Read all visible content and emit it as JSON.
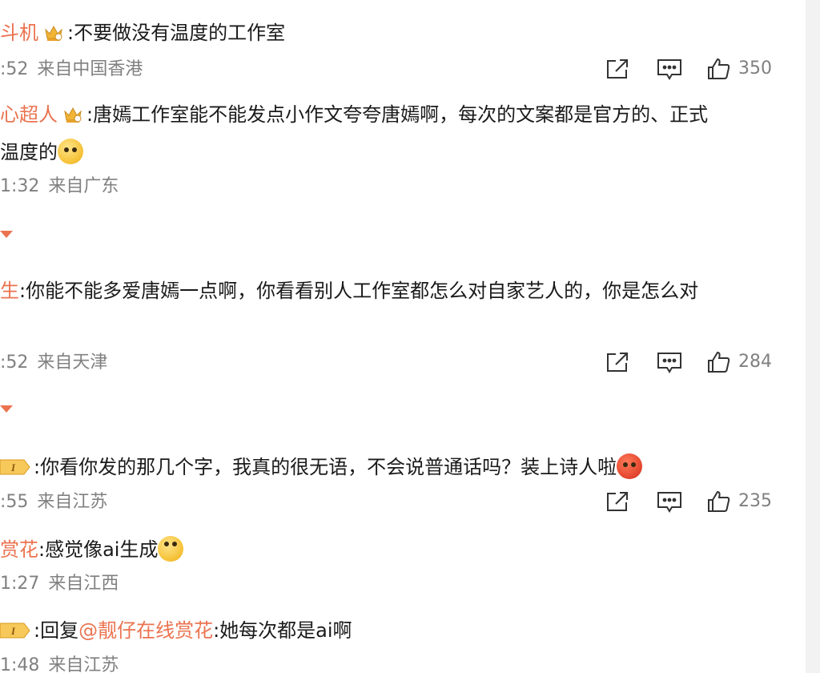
{
  "comments": [
    {
      "username": "斗机",
      "text": ":不要做没有温度的工作室",
      "time": ":52",
      "location": "来自中国香港",
      "likes": "350"
    },
    {
      "username": "心超人",
      "text": ":唐嫣工作室能不能发点小作文夸夸唐嫣啊，每次的文案都是官方的、正式",
      "text_line2": "温度的",
      "time": "1:32",
      "location": "来自广东"
    },
    {
      "username": "生",
      "text": ":你能不能多爱唐嫣一点啊，你看看别人工作室都怎么对自家艺人的，你是怎么对",
      "time": ":52",
      "location": "来自天津",
      "likes": "284"
    },
    {
      "badge": "I",
      "text": ":你看你发的那几个字，我真的很无语，不会说普通话吗？装上诗人啦",
      "time": ":55",
      "location": "来自江苏",
      "likes": "235"
    },
    {
      "username": "赏花",
      "text": ":感觉像ai生成",
      "time": "1:27",
      "location": "来自江西"
    },
    {
      "badge": "I",
      "reply_prefix": ":回复",
      "mention": "@靓仔在线赏花",
      "text": ":她每次都是ai啊",
      "time": "1:48",
      "location": "来自江苏"
    }
  ],
  "colors": {
    "username": "#eb7350",
    "meta": "#808080",
    "text": "#1a1a1a"
  },
  "icons": {
    "share": "share-icon",
    "comment": "comment-icon",
    "like": "thumbs-up-icon"
  }
}
